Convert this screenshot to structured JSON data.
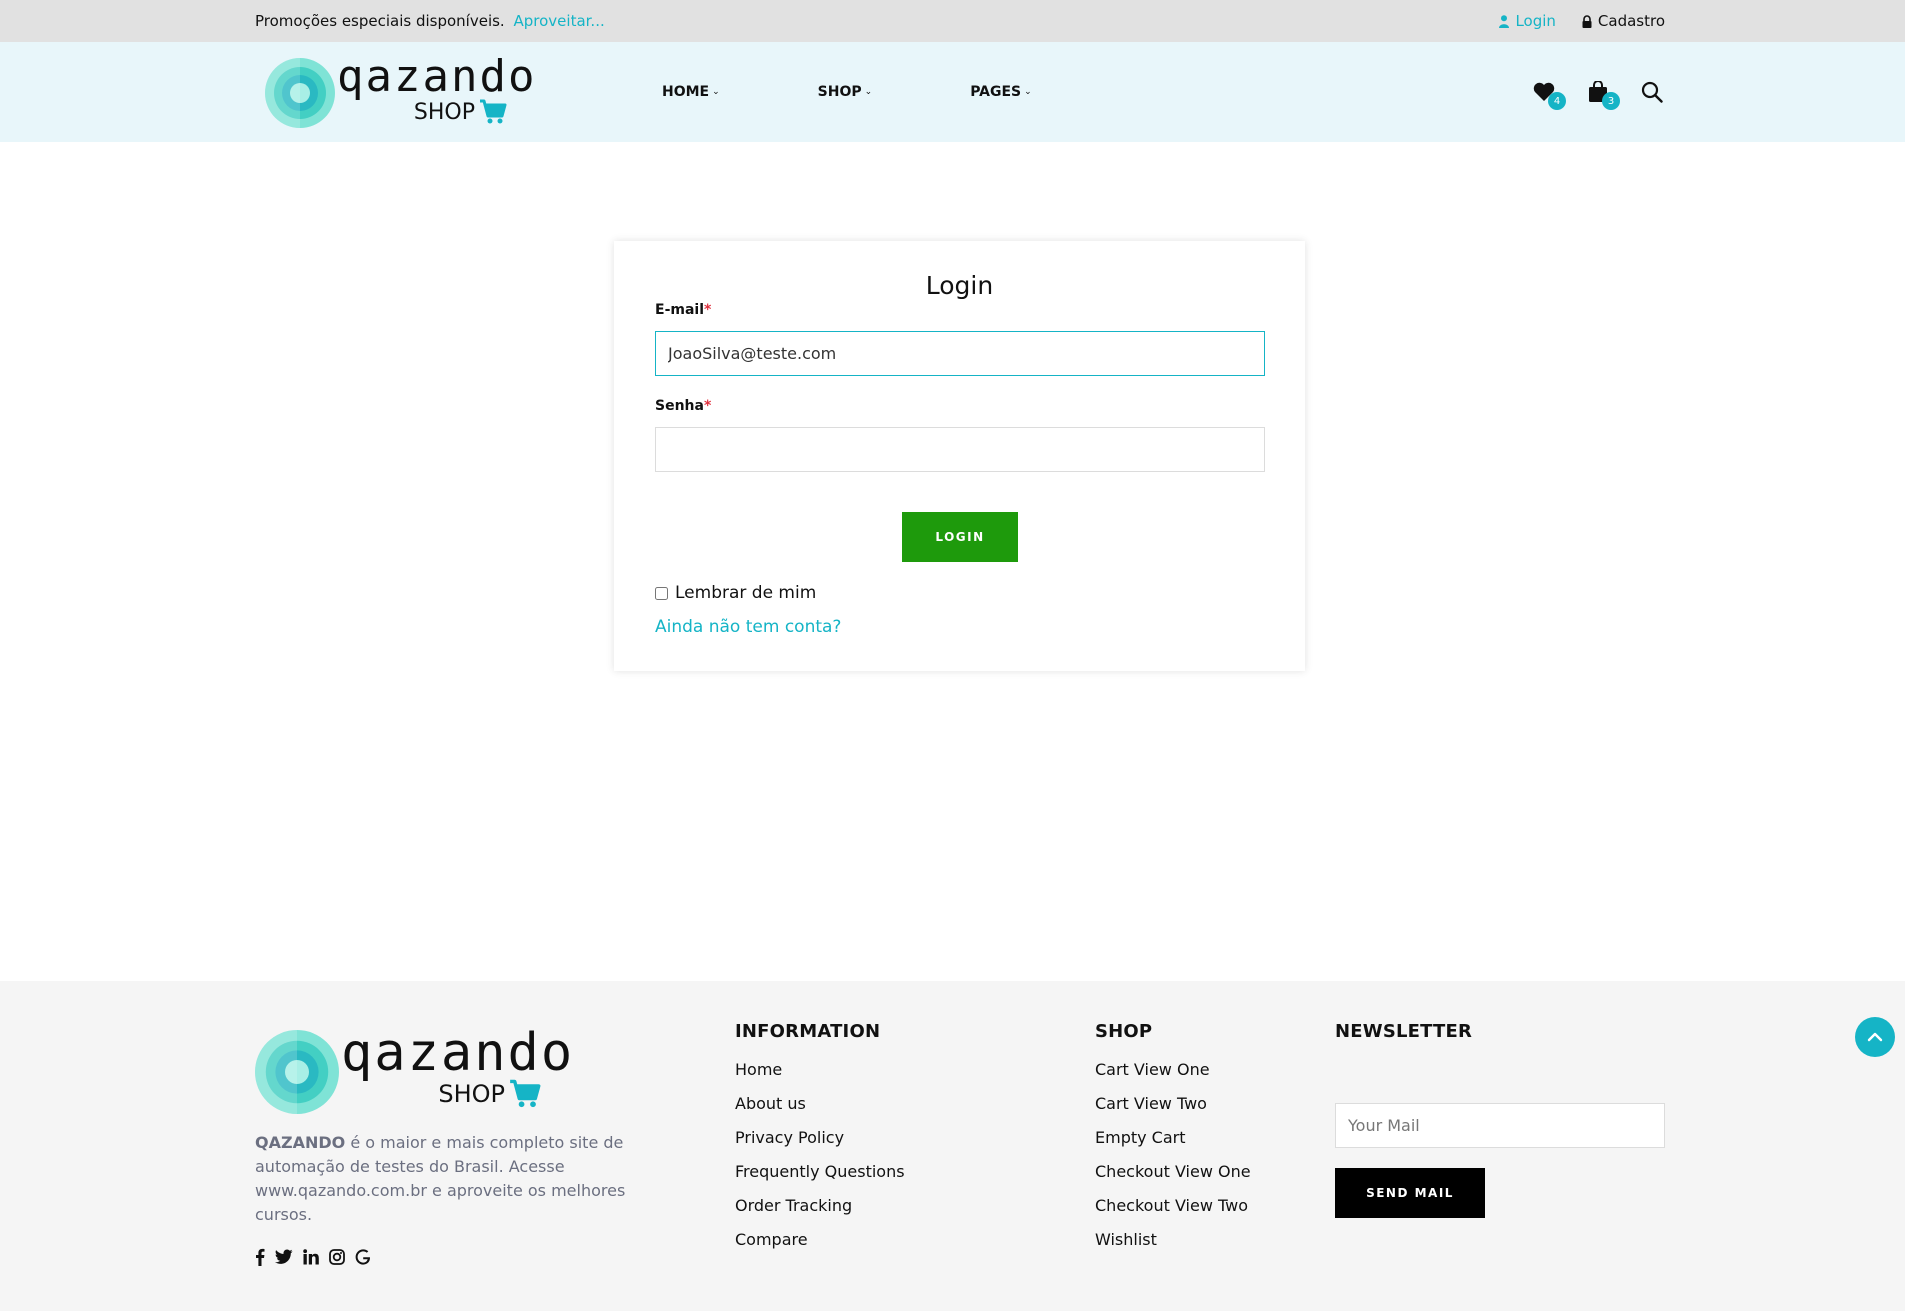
{
  "topbar": {
    "promo_text": "Promoções especiais disponíveis.",
    "promo_link": "Aproveitar...",
    "login_label": "Login",
    "register_label": "Cadastro"
  },
  "header": {
    "logo_word": "qazando",
    "logo_sub": "SHOP",
    "nav": [
      {
        "label": "HOME"
      },
      {
        "label": "SHOP"
      },
      {
        "label": "PAGES"
      }
    ],
    "wishlist_count": "4",
    "cart_count": "3"
  },
  "login_form": {
    "title": "Login",
    "email_label": "E-mail",
    "email_value": "JoaoSilva@teste.com",
    "password_label": "Senha",
    "password_value": "",
    "required_mark": "*",
    "submit_label": "LOGIN",
    "remember_label": "Lembrar de mim",
    "remember_checked": false,
    "register_link": "Ainda não tem conta?"
  },
  "footer": {
    "logo_word": "qazando",
    "logo_sub": "SHOP",
    "about_brand": "QAZANDO",
    "about_text": " é o maior e mais completo site de automação de testes do Brasil. Acesse www.qazando.com.br e aproveite os melhores cursos.",
    "information": {
      "title": "INFORMATION",
      "links": [
        "Home",
        "About us",
        "Privacy Policy",
        "Frequently Questions",
        "Order Tracking",
        "Compare"
      ]
    },
    "shop": {
      "title": "SHOP",
      "links": [
        "Cart View One",
        "Cart View Two",
        "Empty Cart",
        "Checkout View One",
        "Checkout View Two",
        "Wishlist"
      ]
    },
    "newsletter": {
      "title": "NEWSLETTER",
      "placeholder": "Your Mail",
      "button_label": "SEND MAIL"
    },
    "socials": [
      "facebook-icon",
      "twitter-icon",
      "linkedin-icon",
      "instagram-icon",
      "google-icon"
    ]
  },
  "colors": {
    "accent": "#15b4c6",
    "login_button": "#1e9a0c",
    "header_bg": "#e8f6fa",
    "topbar_bg": "#e1e1e1",
    "footer_bg": "#f5f5f5"
  }
}
